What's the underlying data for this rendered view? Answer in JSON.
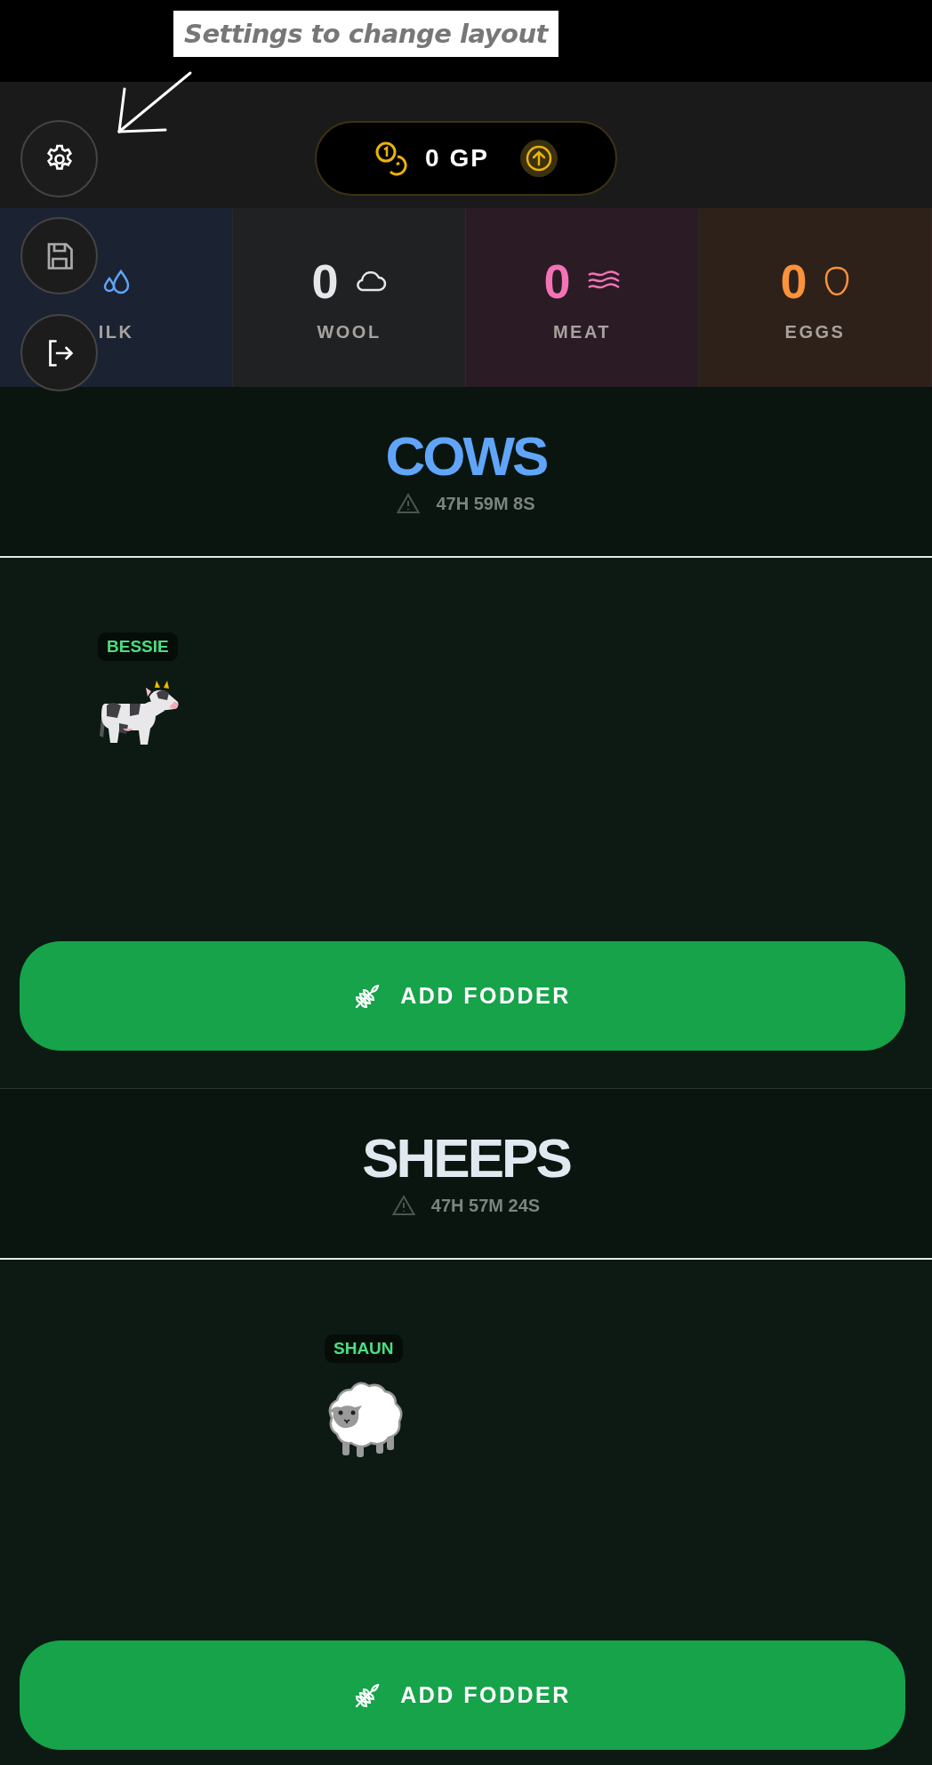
{
  "annotation": {
    "text": "Settings to change layout"
  },
  "currency": {
    "amount": "0 GP"
  },
  "resources": [
    {
      "kind": "milk",
      "label": "ILK",
      "color": "#60a5fa"
    },
    {
      "kind": "wool",
      "value": "0",
      "label": "WOOL",
      "color": "#e5e7eb"
    },
    {
      "kind": "meat",
      "value": "0",
      "label": "MEAT",
      "color": "#f472b6"
    },
    {
      "kind": "eggs",
      "value": "0",
      "label": "EGGS",
      "color": "#fb923c"
    }
  ],
  "pens": [
    {
      "title": "COWS",
      "color": "#60a5fa",
      "timer": "47H 59M 8S",
      "animals": [
        {
          "kind": "cow",
          "name": "BESSIE"
        }
      ],
      "button": "ADD FODDER"
    },
    {
      "title": "SHEEPS",
      "color": "#e2e8f0",
      "timer": "47H 57M 24S",
      "animals": [
        {
          "kind": "sheep",
          "name": "SHAUN"
        }
      ],
      "button": "ADD FODDER"
    }
  ]
}
